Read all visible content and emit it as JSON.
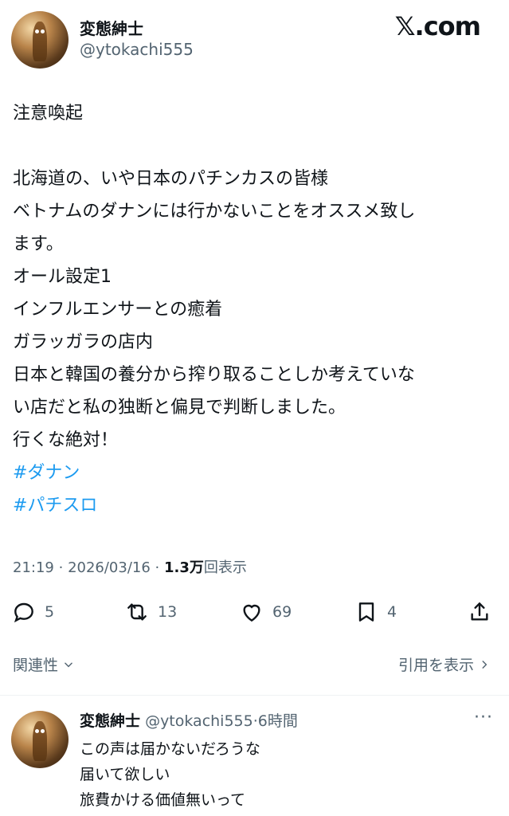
{
  "header": {
    "display_name": "変態紳士",
    "handle": "@ytokachi555",
    "brand": "𝕏.com"
  },
  "tweet": {
    "lines": [
      "注意喚起",
      "",
      "北海道の、いや日本のパチンカスの皆様",
      "ベトナムのダナンには行かないことをオススメ致し",
      "ます。",
      "オール設定1",
      "インフルエンサーとの癒着",
      "ガラッガラの店内",
      "日本と韓国の養分から搾り取ることしか考えていな",
      "い店だと私の独断と偏見で判断しました。",
      "行くな絶対！"
    ],
    "hashtags": [
      "#ダナン",
      "#パチスロ"
    ]
  },
  "meta": {
    "time": "21:19",
    "date": "2026/03/16",
    "views_count": "1.3万",
    "views_label": "回表示"
  },
  "actions": {
    "replies": "5",
    "reposts": "13",
    "likes": "69",
    "bookmarks": "4"
  },
  "links": {
    "related": "関連性",
    "quotes": "引用を表示"
  },
  "reply": {
    "display_name": "変態紳士",
    "handle": "@ytokachi555",
    "separator": "·",
    "time_ago": "6時間",
    "more": "···",
    "lines": [
      "この声は届かないだろうな",
      "届いて欲しい",
      "旅費かける価値無いって"
    ]
  },
  "colors": {
    "accent": "#1d9bf0",
    "secondary_text": "#536471",
    "primary_text": "#0f1419"
  }
}
